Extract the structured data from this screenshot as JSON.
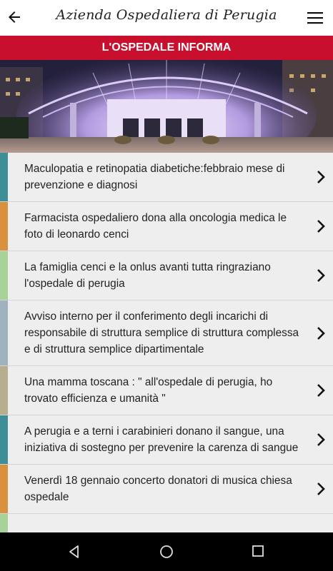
{
  "header": {
    "title": "Azienda Ospedaliera di Perugia"
  },
  "section": {
    "title": "L'OSPEDALE INFORMA"
  },
  "news": [
    {
      "title": "Maculopatia e retinopatia diabetiche:febbraio mese di prevenzione e diagnosi",
      "color": "#3e8e98"
    },
    {
      "title": "Farmacista ospedaliero dona alla oncologia medica le foto di leonardo cenci",
      "color": "#d9913d"
    },
    {
      "title": "La famiglia cenci e la onlus avanti tutta ringraziano l'ospedale di perugia",
      "color": "#a9d29b"
    },
    {
      "title": "Avviso interno per il conferimento degli incarichi di responsabile di struttura semplice di struttura complessa e di struttura semplice dipartimentale",
      "color": "#9fb2bd"
    },
    {
      "title": "Una mamma toscana : \" all'ospedale di perugia, ho trovato efficienza e umanità \"",
      "color": "#b8ad8c"
    },
    {
      "title": "A perugia e a terni i carabinieri donano il sangue, una iniziativa di sostegno per prevenire la carenza di sangue",
      "color": "#3e8e98"
    },
    {
      "title": "Venerdì 18 gennaio concerto donatori di musica chiesa ospedale",
      "color": "#d9913d"
    },
    {
      "title": "",
      "color": "#a9d29b"
    }
  ],
  "colors": {
    "accent": "#c8102e"
  },
  "icons": {
    "back": "arrow-left-icon",
    "menu": "hamburger-menu-icon",
    "row": "chevron-right-icon"
  }
}
